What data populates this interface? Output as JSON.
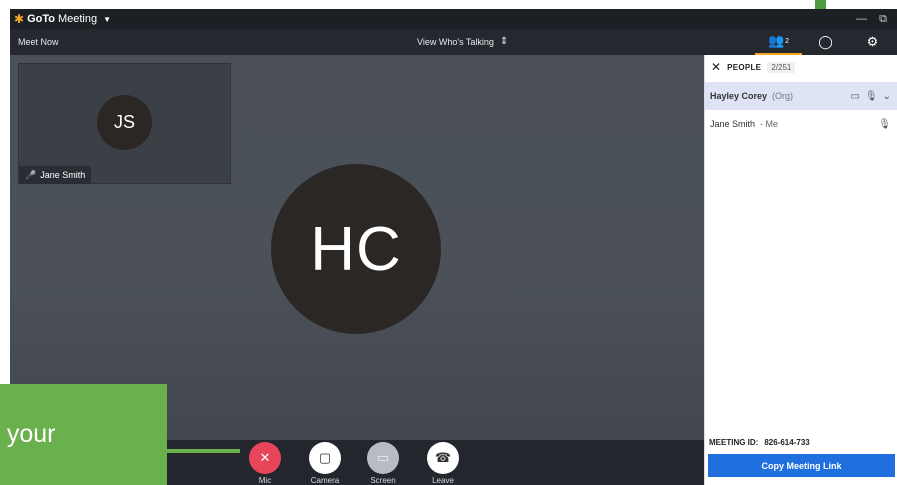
{
  "app": {
    "brand": "GoTo",
    "name": "Meeting"
  },
  "window_controls": {
    "minimize": "—",
    "restore": "⧉"
  },
  "toolbar": {
    "meet_now": "Meet Now",
    "view_mode": "View Who's Talking",
    "people_count": "2"
  },
  "participants_video": {
    "thumb_initials": "JS",
    "thumb_name": "Jane Smith",
    "main_initials": "HC"
  },
  "controls": [
    {
      "label": "Mic",
      "icon": "mic-muted-icon"
    },
    {
      "label": "Camera",
      "icon": "camera-off-icon"
    },
    {
      "label": "Screen",
      "icon": "screen-share-icon"
    },
    {
      "label": "Leave",
      "icon": "hang-up-icon"
    }
  ],
  "callout": {
    "text": "e your"
  },
  "people_panel": {
    "title": "PEOPLE",
    "count": "2/251",
    "people": [
      {
        "name": "Hayley Corey",
        "tag": "(Org)"
      },
      {
        "name": "Jane Smith",
        "tag": "- Me"
      }
    ],
    "meeting_id_label": "MEETING ID:",
    "meeting_id": "826-614-733",
    "copy_link": "Copy Meeting Link"
  },
  "colors": {
    "accent": "#f5a623",
    "mic_muted": "#e8455b",
    "callout_green": "#6ab04c",
    "copy_button": "#1f6fde",
    "host_row": "#dfe3f6"
  }
}
